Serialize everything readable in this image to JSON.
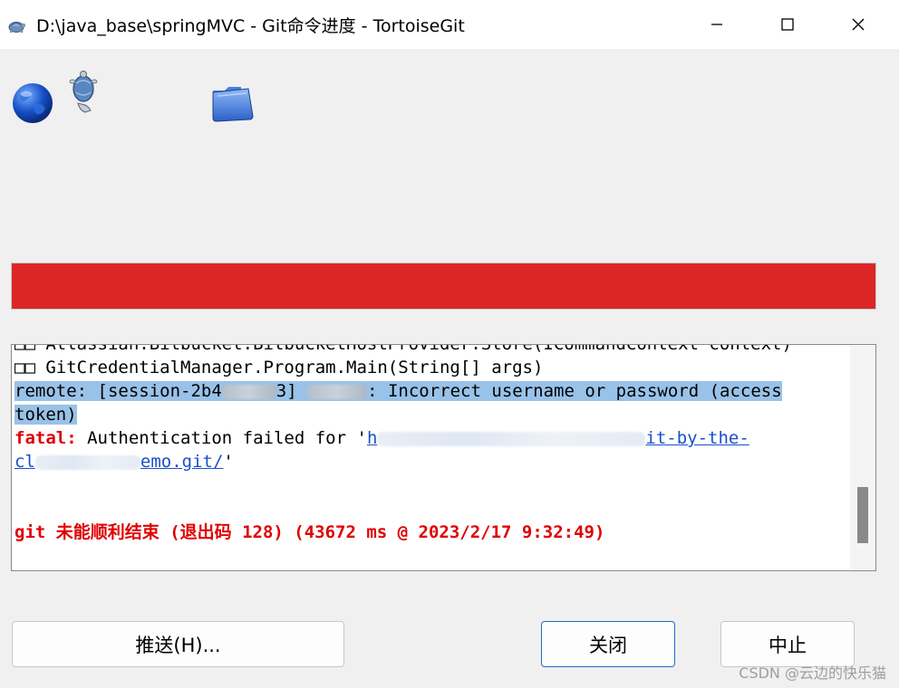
{
  "window": {
    "title": "D:\\java_base\\springMVC - Git命令进度 - TortoiseGit",
    "app_icon": "tortoise-icon",
    "controls": [
      "minimize-icon",
      "maximize-icon",
      "close-icon"
    ]
  },
  "animation_icons": [
    "globe-icon",
    "tortoise-icon",
    "folder-icon"
  ],
  "progress": {
    "value_percent": 100,
    "color": "#dc2626"
  },
  "log": {
    "line0": "□□ Atlassian.Bitbucket.BitbucketHostProvider.Store(ICommandContext context)",
    "line1": "□□ GitCredentialManager.Program.Main(String[] args)",
    "line2_a": "remote: [session-2b4",
    "line2_b": "3] ",
    "line2_c": ": Incorrect username or password (access",
    "line3": "token)",
    "line4_label": "fatal:",
    "line4_text": " Authentication failed for '",
    "line4_link_a": "h",
    "line4_link_b": "it-by-the-",
    "line5_link_a": "cl",
    "line5_link_b": "emo.git/",
    "line5_tail": "'",
    "result": "git 未能顺利结束 (退出码 128) (43672 ms @ 2023/2/17 9:32:49)",
    "highlight_color": "#99c2e8",
    "error_color": "#e00000"
  },
  "buttons": {
    "push": "推送(H)...",
    "close": "关闭",
    "abort": "中止"
  },
  "watermark": "CSDN @云边的快乐猫"
}
